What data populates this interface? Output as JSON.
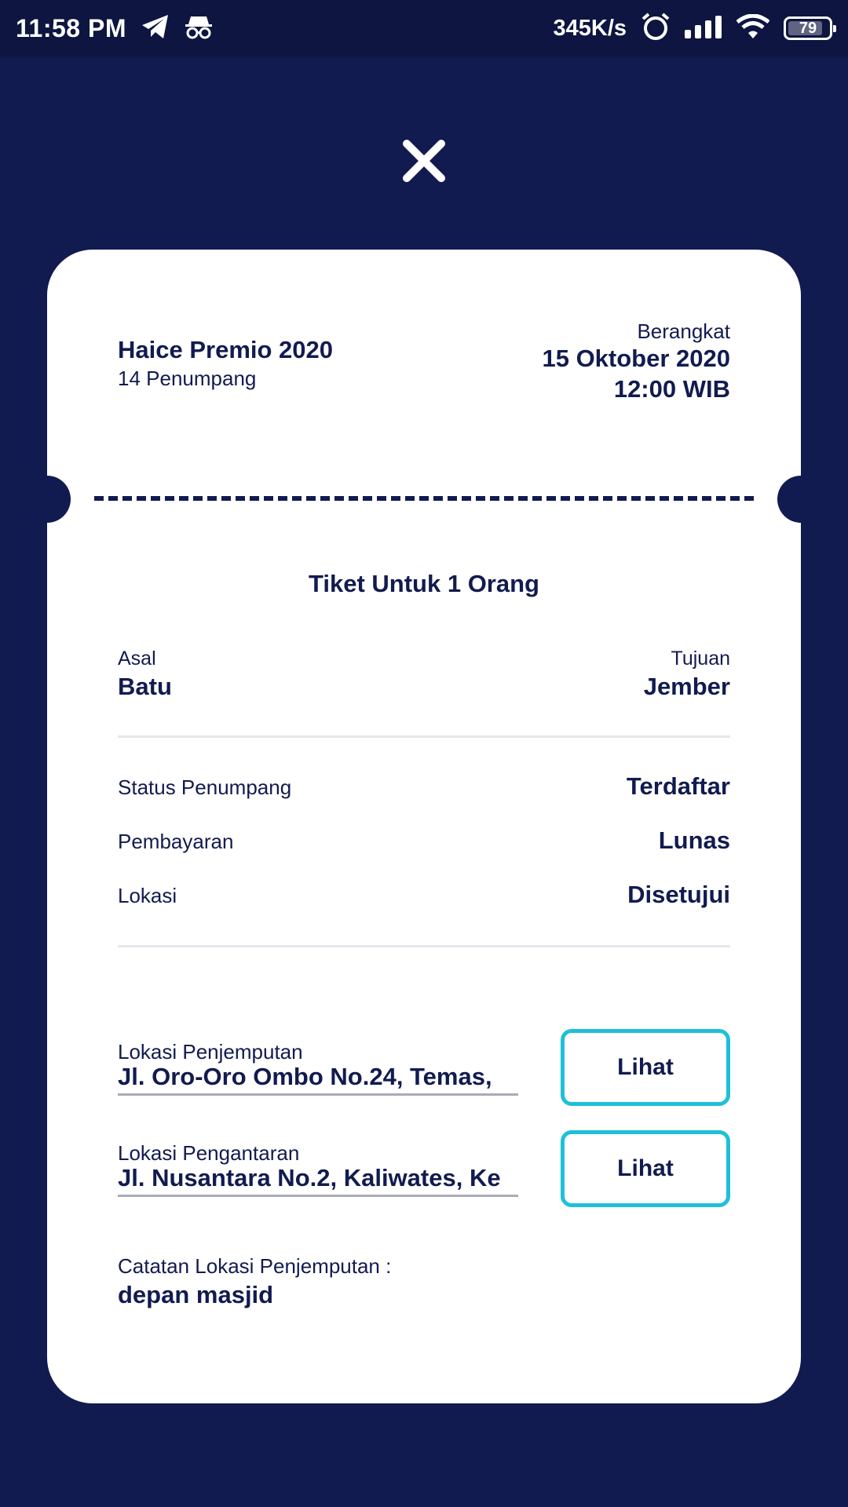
{
  "status_bar": {
    "time": "11:58 PM",
    "network_speed": "345K/s",
    "battery": "79",
    "icons": [
      "telegram-icon",
      "incognito-icon",
      "alarm-icon",
      "signal-icon",
      "wifi-icon",
      "battery-icon"
    ]
  },
  "close_icon": "close-icon",
  "trip": {
    "vehicle": "Haice Premio 2020",
    "passengers": "14 Penumpang",
    "depart_label": "Berangkat",
    "depart_date": "15 Oktober 2020",
    "depart_time": "12:00 WIB"
  },
  "ticket": {
    "title": "Tiket Untuk 1 Orang",
    "origin_label": "Asal",
    "origin": "Batu",
    "destination_label": "Tujuan",
    "destination": "Jember"
  },
  "status_rows": [
    {
      "label": "Status Penumpang",
      "value": "Terdaftar"
    },
    {
      "label": "Pembayaran",
      "value": "Lunas"
    },
    {
      "label": "Lokasi",
      "value": "Disetujui"
    }
  ],
  "locations": {
    "pickup_label": "Lokasi Penjemputan",
    "pickup_value": "Jl. Oro-Oro Ombo No.24, Temas,",
    "pickup_button": "Lihat",
    "dropoff_label": "Lokasi Pengantaran",
    "dropoff_value": "Jl. Nusantara No.2, Kaliwates, Ke",
    "dropoff_button": "Lihat"
  },
  "note": {
    "label": "Catatan Lokasi Penjemputan :",
    "value": "depan masjid"
  },
  "colors": {
    "background": "#121b4f",
    "status_bar": "#0d1540",
    "card": "#ffffff",
    "text": "#121b4f",
    "button_border": "#1ec0d8",
    "divider": "#e6e7ec"
  }
}
